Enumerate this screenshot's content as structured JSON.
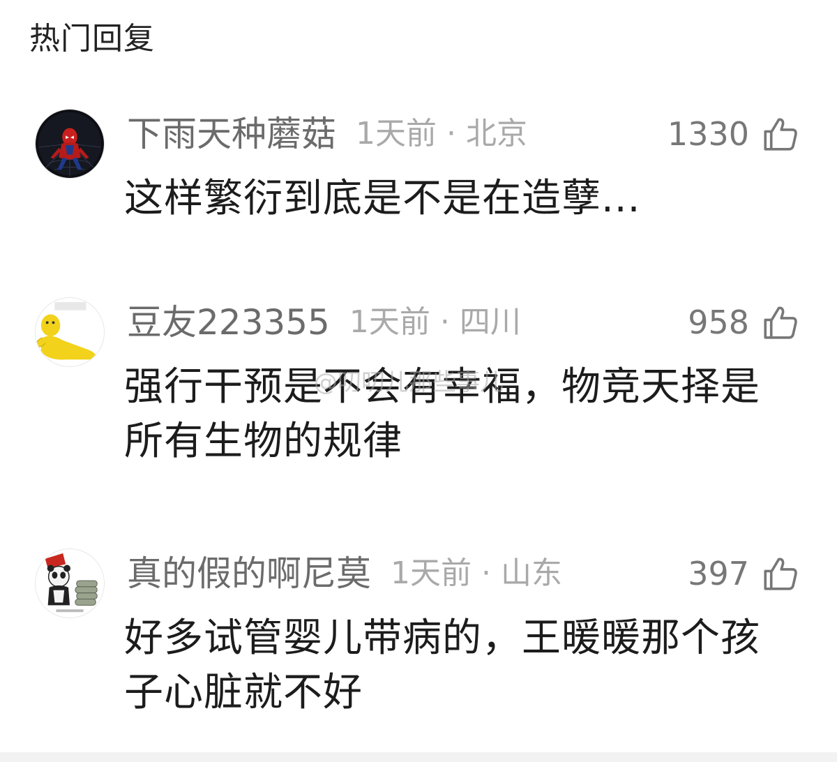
{
  "section_title": "热门回复",
  "watermark": "@叨叨儿那些事儿",
  "colors": {
    "username": "#6b6b6b",
    "meta": "#a9a9a9",
    "body": "#1c1c1c",
    "like": "#777777"
  },
  "comments": [
    {
      "avatar_icon": "spiderman-avatar-icon",
      "username": "下雨天种蘑菇",
      "time": "1天前",
      "separator": "·",
      "location": "北京",
      "likes": "1330",
      "text": "这样繁衍到底是不是在造孽..."
    },
    {
      "avatar_icon": "yellow-figure-avatar-icon",
      "username": "豆友223355",
      "time": "1天前",
      "separator": "·",
      "location": "四川",
      "likes": "958",
      "text": "强行干预是不会有幸福，物竞天择是所有生物的规律"
    },
    {
      "avatar_icon": "panda-meme-avatar-icon",
      "username": "真的假的啊尼莫",
      "time": "1天前",
      "separator": "·",
      "location": "山东",
      "likes": "397",
      "text": "好多试管婴儿带病的，王暖暖那个孩子心脏就不好"
    }
  ]
}
